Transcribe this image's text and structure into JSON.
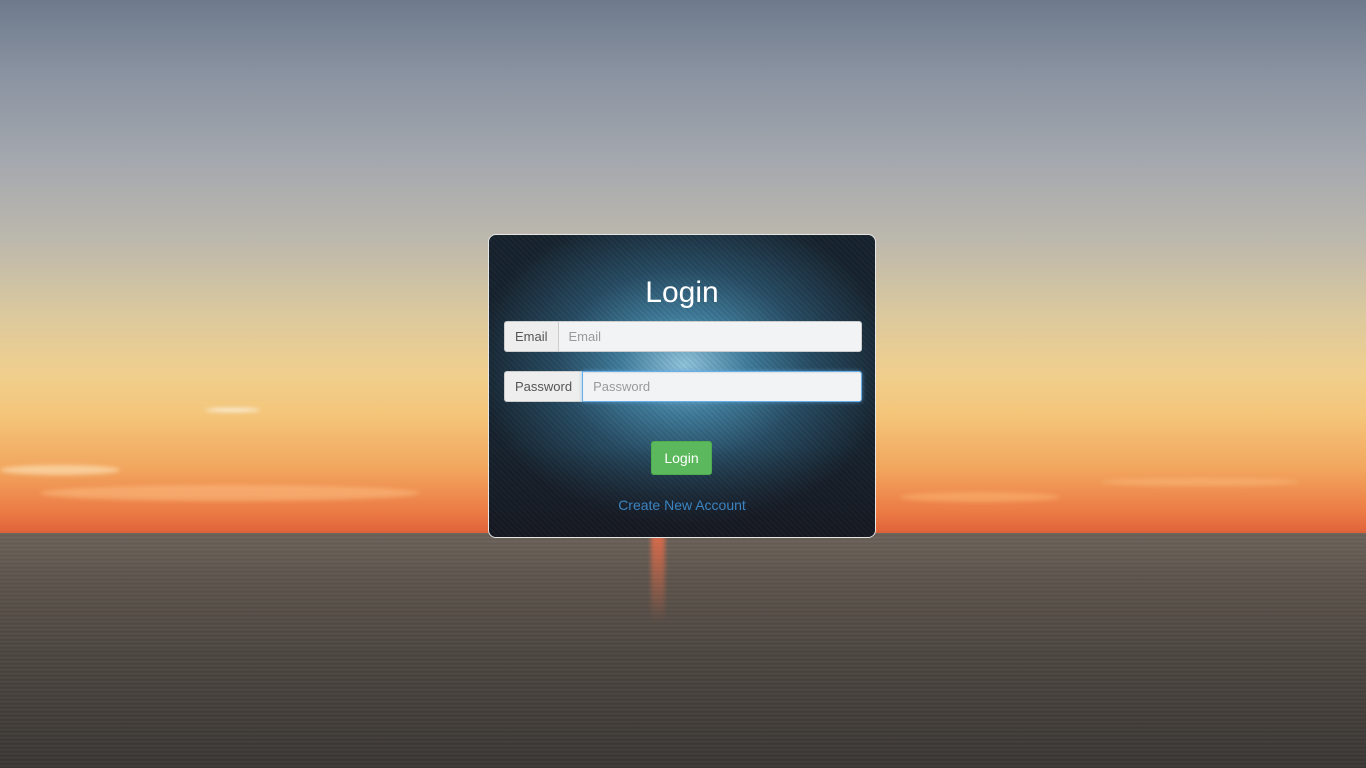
{
  "login_form": {
    "title": "Login",
    "email": {
      "label": "Email",
      "placeholder": "Email",
      "value": ""
    },
    "password": {
      "label": "Password",
      "placeholder": "Password",
      "value": ""
    },
    "submit_label": "Login",
    "create_account_link": "Create New Account"
  },
  "colors": {
    "submit_button": "#5cb85c",
    "link": "#3a84c2",
    "focus_border": "#66afe9"
  }
}
